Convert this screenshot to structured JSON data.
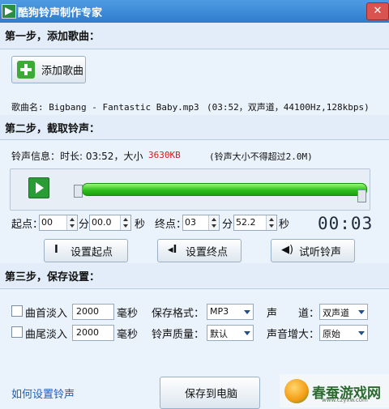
{
  "window": {
    "title": "酷狗铃声制作专家",
    "close_glyph": "✕"
  },
  "step1": {
    "heading": "第一步，添加歌曲：",
    "add_button": "添加歌曲",
    "song_info": "歌曲名: Bigbang - Fantastic Baby.mp3",
    "song_meta": "(03:52，双声道，44100Hz,128kbps)"
  },
  "step2": {
    "heading": "第二步，截取铃声：",
    "info_prefix": "铃声信息：时长: 03:52，大小",
    "info_size": "3630KB",
    "info_note": "(铃声大小不得超过2.0M)",
    "start_label": "起点：",
    "start_min": "00",
    "min_unit": "分",
    "start_sec": "00.0",
    "sec_unit": "秒",
    "end_label": "终点：",
    "end_min": "03",
    "end_sec": "52.2",
    "time_display": "00:03",
    "set_start": "设置起点",
    "set_end": "设置终点",
    "preview": "试听铃声"
  },
  "step3": {
    "heading": "第三步，保存设置：",
    "fade_in_label": "曲首淡入",
    "fade_in_value": "2000",
    "fade_out_label": "曲尾淡入",
    "fade_out_value": "2000",
    "ms_unit": "毫秒",
    "format_label": "保存格式：",
    "format_value": "MP3",
    "quality_label": "铃声质量：",
    "quality_value": "默认",
    "channel_label": "声　　道：",
    "channel_value": "双声道",
    "volume_label": "声音增大：",
    "volume_value": "原始"
  },
  "footer": {
    "help_link": "如何设置铃声",
    "save_button": "保存到电脑"
  },
  "watermark": {
    "text": "春蚕游戏网",
    "sub": "www.czyxw.com"
  },
  "colors": {
    "accent_green": "#2fbf1d",
    "size_red": "#d11c1c",
    "link": "#1e5fb4"
  }
}
